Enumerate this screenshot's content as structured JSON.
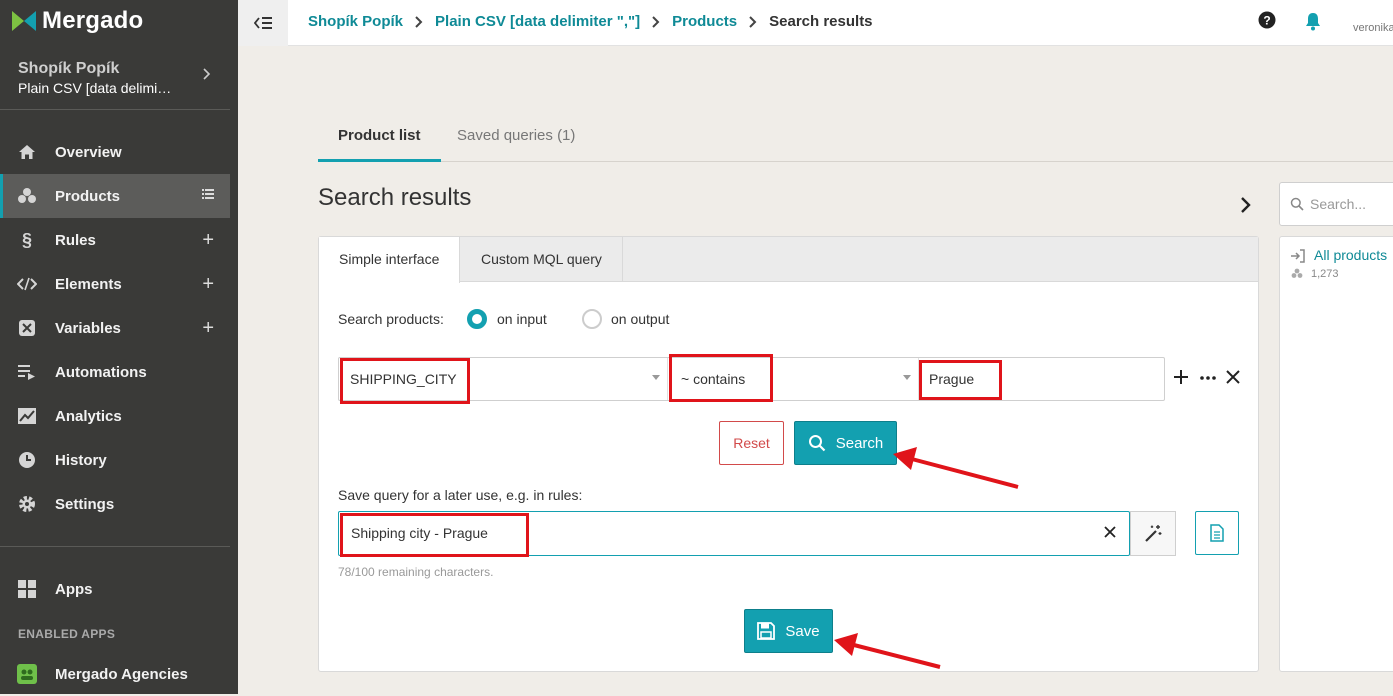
{
  "app": {
    "logo_text": "Mergado"
  },
  "sidebar": {
    "shop_name": "Shopík Popík",
    "feed_name": "Plain CSV [data delimi…",
    "items": [
      {
        "label": "Overview",
        "icon": "home-icon"
      },
      {
        "label": "Products",
        "icon": "boxes-icon",
        "active": true
      },
      {
        "label": "Rules",
        "icon": "paragraph-icon"
      },
      {
        "label": "Elements",
        "icon": "code-icon"
      },
      {
        "label": "Variables",
        "icon": "variable-icon"
      },
      {
        "label": "Automations",
        "icon": "playlist-icon"
      },
      {
        "label": "Analytics",
        "icon": "chart-icon"
      },
      {
        "label": "History",
        "icon": "clock-icon"
      },
      {
        "label": "Settings",
        "icon": "gear-icon"
      }
    ],
    "apps_label": "Apps",
    "enabled_apps_heading": "ENABLED APPS",
    "enabled_apps": [
      {
        "label": "Mergado Agencies",
        "icon": "agencies-icon"
      }
    ]
  },
  "topbar": {
    "breadcrumbs": [
      {
        "label": "Shopík Popík"
      },
      {
        "label": "Plain CSV [data delimiter \",\"]"
      },
      {
        "label": "Products"
      },
      {
        "label": "Search results"
      }
    ],
    "user": "veronika"
  },
  "main": {
    "tabs": [
      {
        "label": "Product list",
        "active": true
      },
      {
        "label": "Saved queries (1)"
      }
    ],
    "title": "Search results",
    "search": {
      "interface_tabs": [
        {
          "label": "Simple interface",
          "active": true
        },
        {
          "label": "Custom MQL query"
        }
      ],
      "search_products_label": "Search products:",
      "radio_options": [
        {
          "label": "on input",
          "checked": true
        },
        {
          "label": "on output",
          "checked": false
        }
      ],
      "field": "SHIPPING_CITY",
      "operator": "~ contains",
      "value": "Prague",
      "reset_label": "Reset",
      "search_label": "Search",
      "save_query_label": "Save query for a later use, e.g. in rules:",
      "save_query_value": "Shipping city - Prague",
      "remaining_text": "78/100 remaining characters.",
      "save_label": "Save"
    }
  },
  "right_panel": {
    "search_placeholder": "Search...",
    "item_title": "All products",
    "item_count": "1,273"
  },
  "colors": {
    "accent": "#13a0b0",
    "sidebar_bg": "#3a3a38",
    "danger": "#d24a4a",
    "annotation": "#e0141a"
  }
}
